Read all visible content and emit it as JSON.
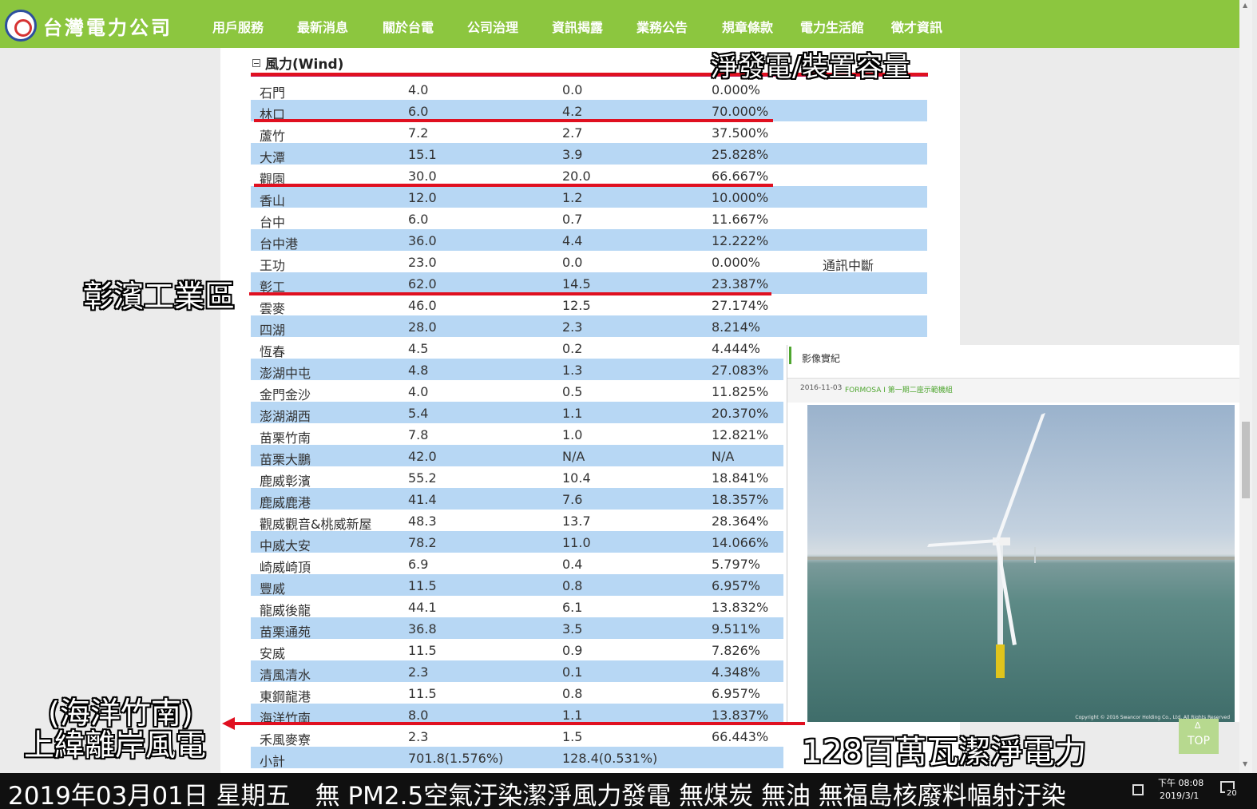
{
  "site": {
    "name": "台灣電力公司"
  },
  "nav": {
    "items": [
      "用戶服務",
      "最新消息",
      "關於台電",
      "公司治理",
      "資訊揭露",
      "業務公告",
      "規章條款",
      "電力生活館",
      "徵才資訊"
    ]
  },
  "section": {
    "title": "風力(Wind)"
  },
  "table": {
    "rows": [
      {
        "name": "石門",
        "capacity": "4.0",
        "net": "0.0",
        "ratio": "0.000%",
        "note": ""
      },
      {
        "name": "林口",
        "capacity": "6.0",
        "net": "4.2",
        "ratio": "70.000%",
        "note": ""
      },
      {
        "name": "蘆竹",
        "capacity": "7.2",
        "net": "2.7",
        "ratio": "37.500%",
        "note": ""
      },
      {
        "name": "大潭",
        "capacity": "15.1",
        "net": "3.9",
        "ratio": "25.828%",
        "note": ""
      },
      {
        "name": "觀園",
        "capacity": "30.0",
        "net": "20.0",
        "ratio": "66.667%",
        "note": ""
      },
      {
        "name": "香山",
        "capacity": "12.0",
        "net": "1.2",
        "ratio": "10.000%",
        "note": ""
      },
      {
        "name": "台中",
        "capacity": "6.0",
        "net": "0.7",
        "ratio": "11.667%",
        "note": ""
      },
      {
        "name": "台中港",
        "capacity": "36.0",
        "net": "4.4",
        "ratio": "12.222%",
        "note": ""
      },
      {
        "name": "王功",
        "capacity": "23.0",
        "net": "0.0",
        "ratio": "0.000%",
        "note": "通訊中斷"
      },
      {
        "name": "彰工",
        "capacity": "62.0",
        "net": "14.5",
        "ratio": "23.387%",
        "note": ""
      },
      {
        "name": "雲麥",
        "capacity": "46.0",
        "net": "12.5",
        "ratio": "27.174%",
        "note": ""
      },
      {
        "name": "四湖",
        "capacity": "28.0",
        "net": "2.3",
        "ratio": "8.214%",
        "note": ""
      },
      {
        "name": "恆春",
        "capacity": "4.5",
        "net": "0.2",
        "ratio": "4.444%",
        "note": ""
      },
      {
        "name": "澎湖中屯",
        "capacity": "4.8",
        "net": "1.3",
        "ratio": "27.083%",
        "note": ""
      },
      {
        "name": "金門金沙",
        "capacity": "4.0",
        "net": "0.5",
        "ratio": "11.825%",
        "note": ""
      },
      {
        "name": "澎湖湖西",
        "capacity": "5.4",
        "net": "1.1",
        "ratio": "20.370%",
        "note": ""
      },
      {
        "name": "苗栗竹南",
        "capacity": "7.8",
        "net": "1.0",
        "ratio": "12.821%",
        "note": ""
      },
      {
        "name": "苗栗大鵬",
        "capacity": "42.0",
        "net": "N/A",
        "ratio": "N/A",
        "note": ""
      },
      {
        "name": "鹿威彰濱",
        "capacity": "55.2",
        "net": "10.4",
        "ratio": "18.841%",
        "note": ""
      },
      {
        "name": "鹿威鹿港",
        "capacity": "41.4",
        "net": "7.6",
        "ratio": "18.357%",
        "note": ""
      },
      {
        "name": "觀威觀音&桃威新屋",
        "capacity": "48.3",
        "net": "13.7",
        "ratio": "28.364%",
        "note": ""
      },
      {
        "name": "中威大安",
        "capacity": "78.2",
        "net": "11.0",
        "ratio": "14.066%",
        "note": ""
      },
      {
        "name": "崎威崎頂",
        "capacity": "6.9",
        "net": "0.4",
        "ratio": "5.797%",
        "note": ""
      },
      {
        "name": "豐威",
        "capacity": "11.5",
        "net": "0.8",
        "ratio": "6.957%",
        "note": ""
      },
      {
        "name": "龍威後龍",
        "capacity": "44.1",
        "net": "6.1",
        "ratio": "13.832%",
        "note": ""
      },
      {
        "name": "苗栗通苑",
        "capacity": "36.8",
        "net": "3.5",
        "ratio": "9.511%",
        "note": ""
      },
      {
        "name": "安威",
        "capacity": "11.5",
        "net": "0.9",
        "ratio": "7.826%",
        "note": ""
      },
      {
        "name": "清風清水",
        "capacity": "2.3",
        "net": "0.1",
        "ratio": "4.348%",
        "note": ""
      },
      {
        "name": "東鋼龍港",
        "capacity": "11.5",
        "net": "0.8",
        "ratio": "6.957%",
        "note": ""
      },
      {
        "name": "海洋竹南",
        "capacity": "8.0",
        "net": "1.1",
        "ratio": "13.837%",
        "note": ""
      },
      {
        "name": "禾風麥寮",
        "capacity": "2.3",
        "net": "1.5",
        "ratio": "66.443%",
        "note": ""
      },
      {
        "name": "小計",
        "capacity": "701.8(1.576%)",
        "net": "128.4(0.531%)",
        "ratio": "",
        "note": ""
      }
    ]
  },
  "panel": {
    "title": "影像實紀",
    "date": "2016-11-03",
    "link": "FORMOSA I 第一期二座示範機組",
    "copyright": "Copyright © 2016 Swancor Holding Co., Ltd. All Rights Reserved"
  },
  "top_button": {
    "arrow": "∆",
    "label": "TOP"
  },
  "annotations": {
    "net_over_capacity": "淨發電/裝置容量",
    "changbin": "彰濱工業區",
    "haiyang_1": "(海洋竹南)",
    "haiyang_2": "上緯離岸風電",
    "clean_power": "128百萬瓦潔淨電力"
  },
  "ticker": {
    "text": "2019年03月01日 星期五　無 PM2.5空氣汙染潔淨風力發電 無煤炭 無油 無福島核廢料幅射汙染"
  },
  "clock": {
    "time": "下午 08:08",
    "date": "2019/3/1"
  },
  "notification_count": "20",
  "colors": {
    "nav_green": "#8cc63f",
    "row_blue": "#b7d7f4",
    "underline_red": "#e01020",
    "header_rule": "#c2185b"
  }
}
